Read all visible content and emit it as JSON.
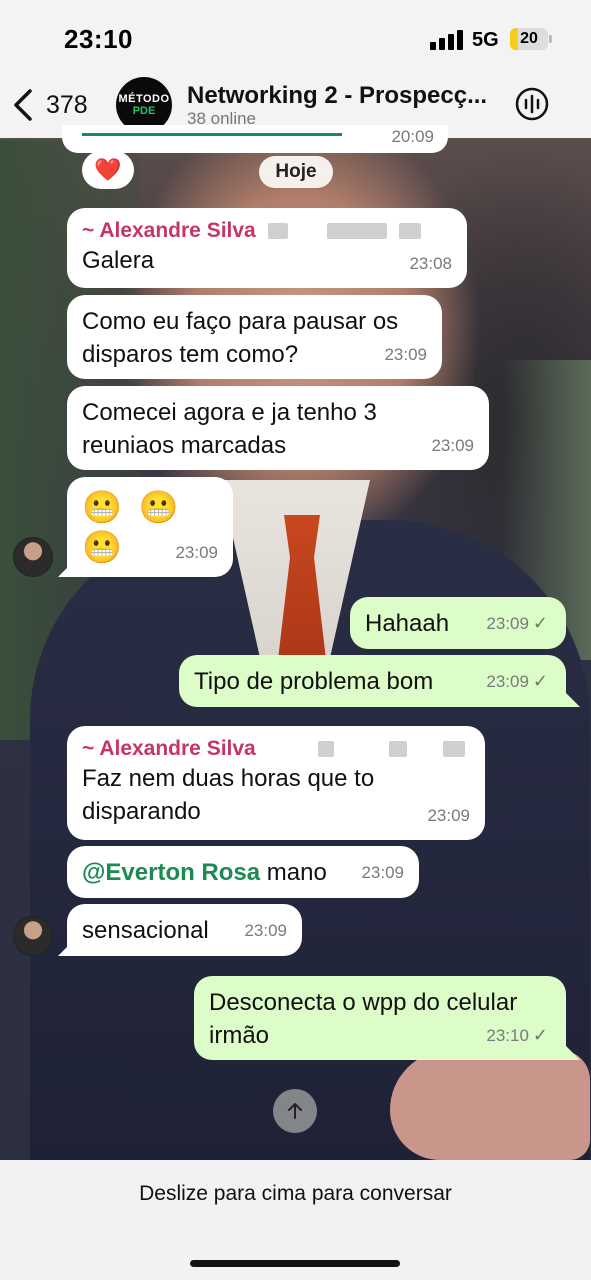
{
  "status_bar": {
    "time": "23:10",
    "network": "5G",
    "battery_level": "20",
    "battery_fraction": 0.2,
    "battery_color": "#f6cc1d"
  },
  "header": {
    "back_count": "378",
    "group_avatar_line1": "MÉTODO",
    "group_avatar_line2": "PDE",
    "group_name": "Networking 2 - Prospecç...",
    "group_status": "38 online",
    "back_icon": "chevron-left-icon",
    "audio_icon": "audio-waveform-icon"
  },
  "chat": {
    "partial_prev_time": "20:09",
    "reaction_emoji": "❤️",
    "date_chip": "Hoje",
    "messages": [
      {
        "sender": "~ Alexandre Silva",
        "text": "Galera",
        "time": "23:08"
      },
      {
        "text": "Como eu faço para pausar os disparos tem como?",
        "line1": "Como eu faço para pausar os",
        "line2": "disparos tem como?",
        "time": "23:09"
      },
      {
        "text": "Comecei agora e ja tenho 3 reuniaos marcadas",
        "line1": "Comecei agora e ja tenho 3",
        "line2": "reuniaos marcadas",
        "time": "23:09"
      },
      {
        "text": "😬 😬 😬",
        "emoji": "😬",
        "time": "23:09"
      },
      {
        "text": "Hahaah",
        "time": "23:09",
        "outgoing": true
      },
      {
        "text": "Tipo de problema bom",
        "time": "23:09",
        "outgoing": true
      },
      {
        "sender": "~ Alexandre Silva",
        "line1": "Faz nem duas horas que to",
        "line2": "disparando",
        "time": "23:09"
      },
      {
        "mention": "@Everton Rosa",
        "text": " mano",
        "time": "23:09"
      },
      {
        "text": "sensacional",
        "time": "23:09"
      },
      {
        "line1": "Desconecta o wpp do celular",
        "line2": "irmão",
        "time": "23:10",
        "outgoing": true
      }
    ],
    "check_mark": "✓",
    "colors": {
      "incoming_bubble": "#ffffff",
      "outgoing_bubble": "#dcfcc8",
      "sender_name": "#c8336a",
      "mention": "#1b8a54"
    }
  },
  "bottom": {
    "prompt": "Deslize para cima para conversar",
    "scroll_icon": "arrow-up-icon"
  }
}
